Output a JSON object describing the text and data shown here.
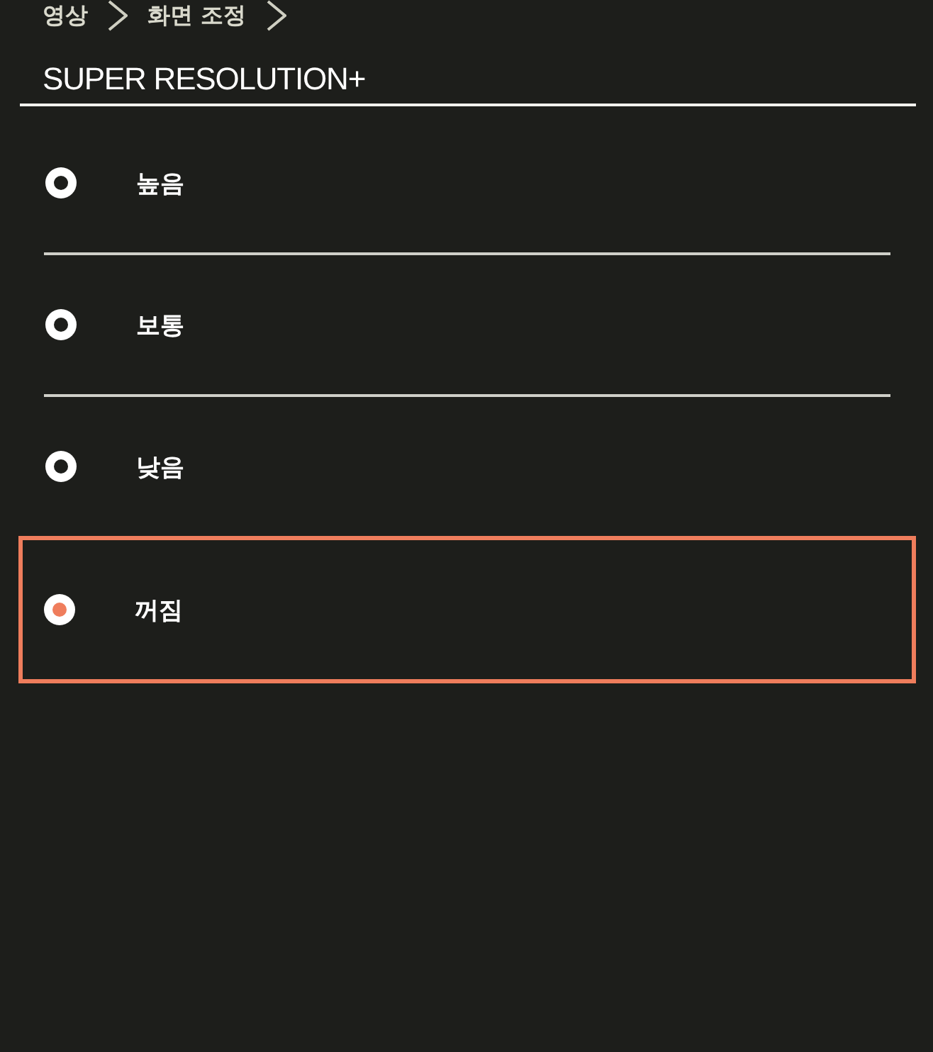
{
  "breadcrumb": [
    {
      "label": "영상"
    },
    {
      "label": "화면 조정"
    }
  ],
  "title": "SUPER RESOLUTION+",
  "options": [
    {
      "label": "높음",
      "selected": false
    },
    {
      "label": "보통",
      "selected": false
    },
    {
      "label": "낮음",
      "selected": false
    },
    {
      "label": "꺼짐",
      "selected": true
    }
  ]
}
